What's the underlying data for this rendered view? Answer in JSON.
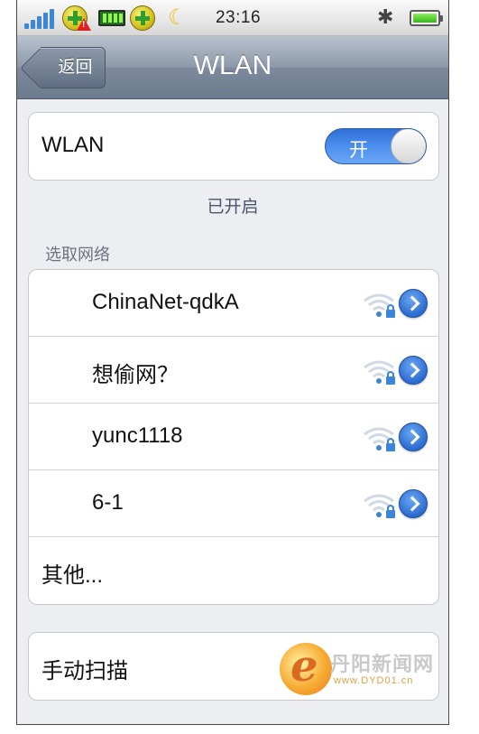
{
  "status_bar": {
    "time": "23:16",
    "icons": [
      "signal-icon",
      "app-plus-icon",
      "warning-icon",
      "battery-app-icon",
      "app-plus-icon",
      "moon-icon",
      "bluetooth-icon",
      "battery-icon"
    ]
  },
  "nav": {
    "back_label": "返回",
    "title": "WLAN"
  },
  "wlan_toggle": {
    "label": "WLAN",
    "state_label": "开",
    "on": true
  },
  "wlan_status": "已开启",
  "networks_header": "选取网络",
  "networks": [
    {
      "name": "ChinaNet-qdkA",
      "selected": false,
      "secured": true,
      "signal": 1
    },
    {
      "name": "想偷网？",
      "secured": true,
      "signal": 1
    },
    {
      "name": "yunc1118",
      "secured": true,
      "signal": 1
    },
    {
      "name": "6-1",
      "secured": true,
      "signal": 1
    }
  ],
  "other_label": "其他...",
  "manual_scan_label": "手动扫描",
  "watermark": {
    "text": "丹阳新闻网",
    "sub": "www.DYD01.cn"
  },
  "colors": {
    "accent": "#3b86d8",
    "nav_bg": "#7d8a9d",
    "toggle_on": "#4d8ff0",
    "background": "#eceef1"
  }
}
